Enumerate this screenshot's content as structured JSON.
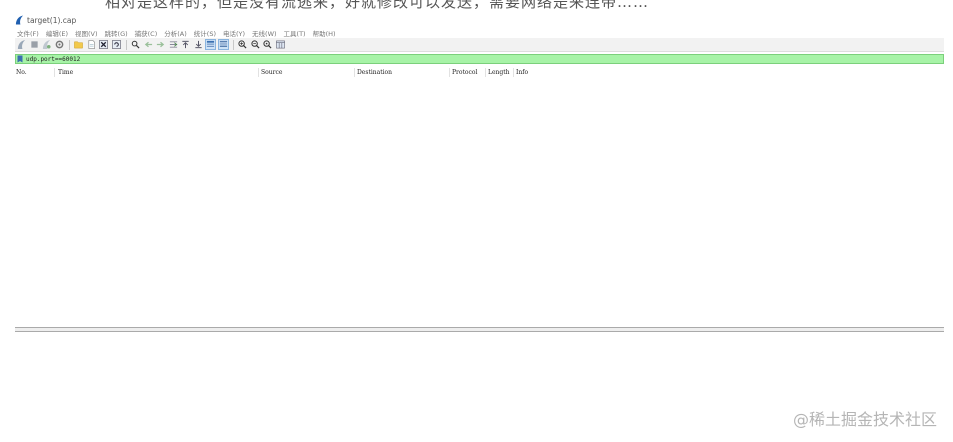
{
  "top_cut_text": "相对是这样的，但是没有流逃来，好就修改可以发送，需要网络是来连带……",
  "window": {
    "title": "target(1).cap"
  },
  "menu": [
    {
      "label": "文件(F)"
    },
    {
      "label": "编辑(E)"
    },
    {
      "label": "视图(V)"
    },
    {
      "label": "跳转(G)"
    },
    {
      "label": "捕获(C)"
    },
    {
      "label": "分析(A)"
    },
    {
      "label": "统计(S)"
    },
    {
      "label": "电话(Y)"
    },
    {
      "label": "无线(W)"
    },
    {
      "label": "工具(T)"
    },
    {
      "label": "帮助(H)"
    }
  ],
  "filter": {
    "value": "udp.port==60012"
  },
  "columns": [
    {
      "key": "no",
      "label": "No."
    },
    {
      "key": "time",
      "label": "Time"
    },
    {
      "key": "source",
      "label": "Source"
    },
    {
      "key": "destination",
      "label": "Destination"
    },
    {
      "key": "protocol",
      "label": "Protocol"
    },
    {
      "key": "length",
      "label": "Length"
    },
    {
      "key": "info",
      "label": "Info"
    }
  ],
  "packets": [],
  "watermark": "@稀土掘金技术社区",
  "colors": {
    "filter_valid_bg": "#a7f3a7",
    "toolbar_bg": "#f2f2f2",
    "icon_blue": "#1f5fb0"
  }
}
